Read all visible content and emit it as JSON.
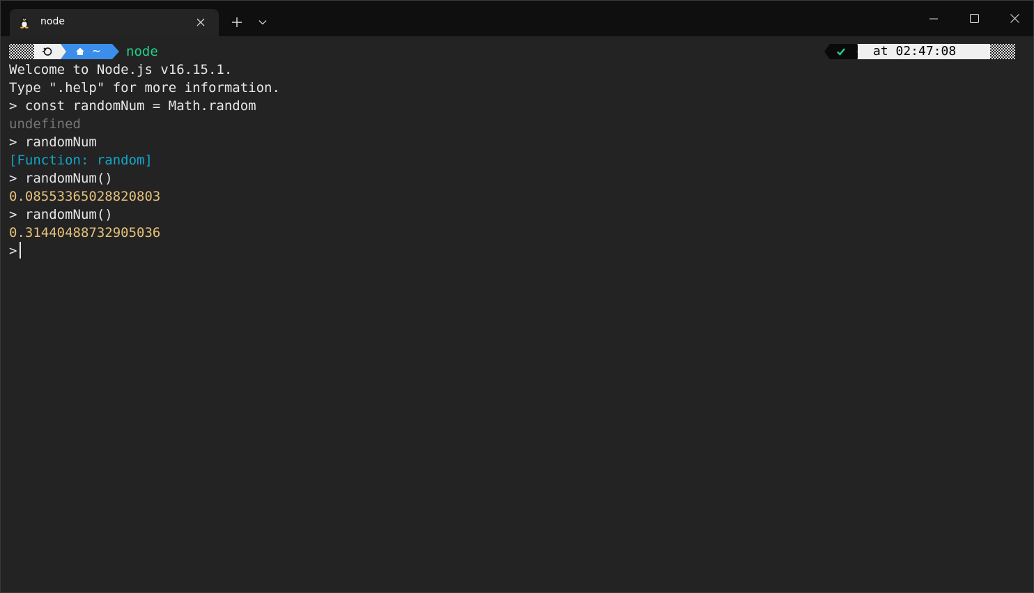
{
  "tab": {
    "title": "node",
    "icon": "linux-penguin-icon"
  },
  "window_controls": [
    "minimize",
    "maximize",
    "close"
  ],
  "prompt": {
    "os_icon": "circle-q-icon",
    "path_icon": "home-icon",
    "path": "~",
    "command": "node",
    "status_icon": "check-icon",
    "time_text": "at 02:47:08",
    "clock_icon": "clock-icon"
  },
  "terminal": {
    "lines": [
      {
        "text": "Welcome to Node.js v16.15.1.",
        "kind": "output"
      },
      {
        "text": "Type \".help\" for more information.",
        "kind": "output"
      },
      {
        "text": "> const randomNum = Math.random",
        "kind": "input"
      },
      {
        "text": "undefined",
        "kind": "undefined"
      },
      {
        "text": "> randomNum",
        "kind": "input"
      },
      {
        "text": "[Function: random]",
        "kind": "function"
      },
      {
        "text": "> randomNum()",
        "kind": "input"
      },
      {
        "text": "0.08553365028820803",
        "kind": "number"
      },
      {
        "text": "> randomNum()",
        "kind": "input"
      },
      {
        "text": "0.31440488732905036",
        "kind": "number"
      }
    ],
    "current_prompt": ">"
  },
  "colors": {
    "background": "#232323",
    "titlebar": "#0f0f0f",
    "prompt_green": "#23d18b",
    "path_blue": "#3b8eea",
    "function_cyan": "#11a8cd",
    "number_yellow": "#e5c07b",
    "undefined_gray": "#767676"
  }
}
